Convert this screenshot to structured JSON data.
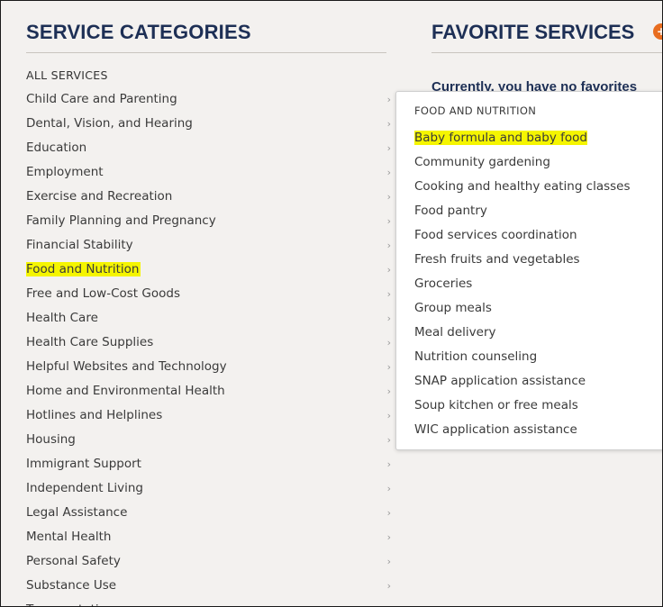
{
  "categories_heading": "SERVICE CATEGORIES",
  "all_services": "ALL SERVICES",
  "categories": [
    {
      "label": "Child Care and Parenting"
    },
    {
      "label": "Dental, Vision, and Hearing"
    },
    {
      "label": "Education"
    },
    {
      "label": "Employment"
    },
    {
      "label": "Exercise and Recreation"
    },
    {
      "label": "Family Planning and Pregnancy"
    },
    {
      "label": "Financial Stability"
    },
    {
      "label": "Food and Nutrition",
      "active": true
    },
    {
      "label": "Free and Low-Cost Goods"
    },
    {
      "label": "Health Care"
    },
    {
      "label": "Health Care Supplies"
    },
    {
      "label": "Helpful Websites and Technology"
    },
    {
      "label": "Home and Environmental Health"
    },
    {
      "label": "Hotlines and Helplines"
    },
    {
      "label": "Housing"
    },
    {
      "label": "Immigrant Support"
    },
    {
      "label": "Independent Living"
    },
    {
      "label": "Legal Assistance"
    },
    {
      "label": "Mental Health"
    },
    {
      "label": "Personal Safety"
    },
    {
      "label": "Substance Use"
    },
    {
      "label": "Transportation"
    }
  ],
  "favorites_heading": "FAVORITE SERVICES",
  "favorites_empty": "Currently, you have no favorites",
  "dropdown": {
    "title": "FOOD AND NUTRITION",
    "items": [
      {
        "label": "Baby formula and baby food",
        "highlight": true
      },
      {
        "label": "Community gardening"
      },
      {
        "label": "Cooking and healthy eating classes"
      },
      {
        "label": "Food pantry"
      },
      {
        "label": "Food services coordination"
      },
      {
        "label": "Fresh fruits and vegetables"
      },
      {
        "label": "Groceries"
      },
      {
        "label": "Group meals"
      },
      {
        "label": "Meal delivery"
      },
      {
        "label": "Nutrition counseling"
      },
      {
        "label": "SNAP application assistance"
      },
      {
        "label": "Soup kitchen or free meals"
      },
      {
        "label": "WIC application assistance"
      }
    ]
  },
  "colors": {
    "heading": "#1d2f55",
    "highlight": "#f5f500",
    "badge": "#e86d1f"
  }
}
